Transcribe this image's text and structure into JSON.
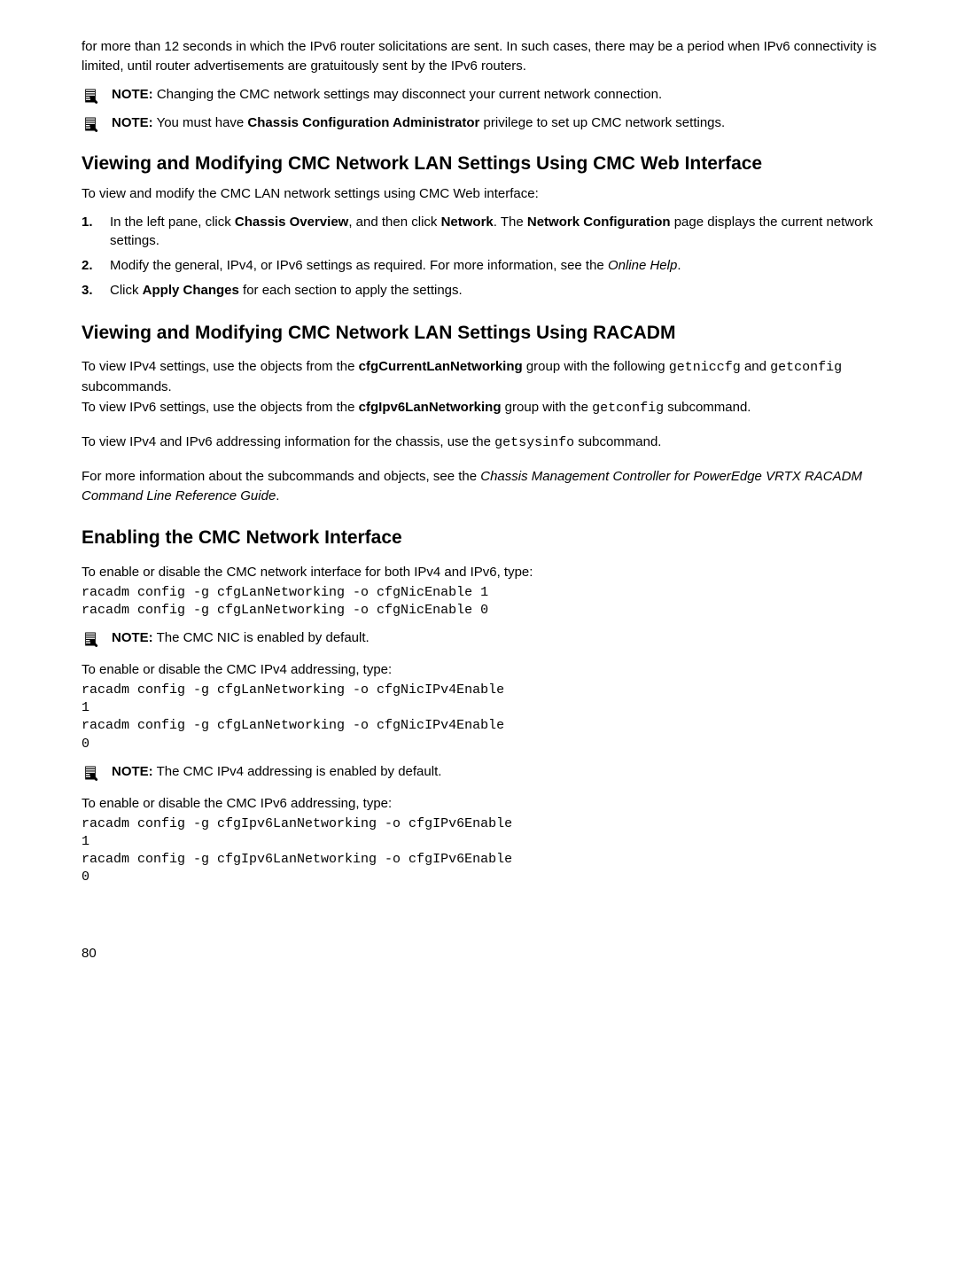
{
  "intro_para": "for more than 12 seconds in which the IPv6 router solicitations are sent. In such cases, there may be a period when IPv6 connectivity is limited, until router advertisements are gratuitously sent by the IPv6 routers.",
  "note1": {
    "label": "NOTE:",
    "text": " Changing the CMC network settings may disconnect your current network connection."
  },
  "note2": {
    "label": "NOTE:",
    "pre": " You must have ",
    "bold": "Chassis Configuration Administrator",
    "post": " privilege to set up CMC network settings."
  },
  "section1": {
    "title": "Viewing and Modifying CMC Network LAN Settings Using CMC Web Interface",
    "intro": "To view and modify the CMC LAN network settings using CMC Web interface:",
    "steps": [
      {
        "num": "1.",
        "pre": "In the left pane, click ",
        "b1": "Chassis Overview",
        "mid1": ", and then click ",
        "b2": "Network",
        "mid2": ". The ",
        "b3": "Network Configuration",
        "post": " page displays the current network settings."
      },
      {
        "num": "2.",
        "pre": "Modify the general, IPv4, or IPv6 settings as required. For more information, see the ",
        "italic": "Online Help",
        "post": "."
      },
      {
        "num": "3.",
        "pre": "Click ",
        "b1": "Apply Changes",
        "post": " for each section to apply the settings."
      }
    ]
  },
  "section2": {
    "title": "Viewing and Modifying CMC Network LAN Settings Using RACADM",
    "p1_pre": "To view IPv4 settings, use the objects from the ",
    "p1_bold": "cfgCurrentLanNetworking",
    "p1_mid": " group with the following ",
    "p1_mono1": "getniccfg",
    "p1_and": " and ",
    "p1_mono2": "getconfig",
    "p1_post": " subcommands.",
    "p2_pre": "To view IPv6 settings, use the objects from the ",
    "p2_bold": "cfgIpv6LanNetworking",
    "p2_mid": " group with the ",
    "p2_mono": "getconfig",
    "p2_post": " subcommand.",
    "p3_pre": "To view IPv4 and IPv6 addressing information for the chassis, use the ",
    "p3_mono": "getsysinfo",
    "p3_post": " subcommand.",
    "p4_pre": "For more information about the subcommands and objects, see the ",
    "p4_italic": "Chassis Management Controller for PowerEdge VRTX RACADM Command Line Reference Guide",
    "p4_post": "."
  },
  "section3": {
    "title": "Enabling the CMC Network Interface",
    "p1": "To enable or disable the CMC network interface for both IPv4 and IPv6, type:",
    "code1": "racadm config -g cfgLanNetworking -o cfgNicEnable 1\nracadm config -g cfgLanNetworking -o cfgNicEnable 0",
    "note1": {
      "label": "NOTE:",
      "text": " The CMC NIC is enabled by default."
    },
    "p2": "To enable or disable the CMC IPv4 addressing, type:",
    "code2": "racadm config -g cfgLanNetworking -o cfgNicIPv4Enable\n1\nracadm config -g cfgLanNetworking -o cfgNicIPv4Enable\n0",
    "note2": {
      "label": "NOTE:",
      "text": " The CMC IPv4 addressing is enabled by default."
    },
    "p3": "To enable or disable the CMC IPv6 addressing, type:",
    "code3": "racadm config -g cfgIpv6LanNetworking -o cfgIPv6Enable\n1\nracadm config -g cfgIpv6LanNetworking -o cfgIPv6Enable\n0"
  },
  "page_number": "80"
}
